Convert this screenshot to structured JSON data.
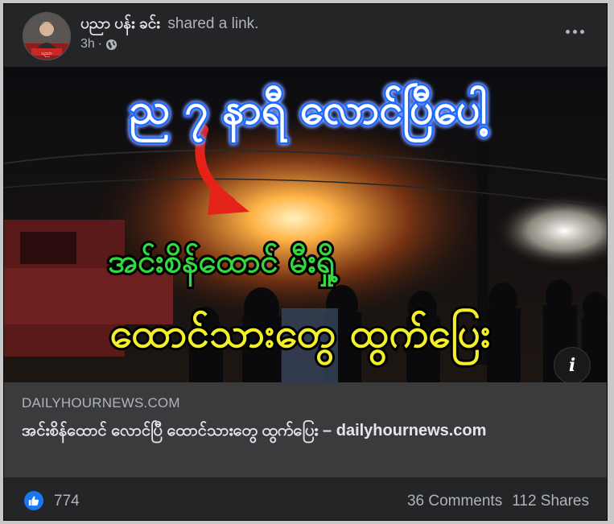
{
  "post": {
    "author": "ပညာ ပန်း ခင်း",
    "action": "shared a link.",
    "timestamp": "3h",
    "separator": "·",
    "privacy_icon": "globe-icon",
    "avatar_caption": "ပညာ",
    "more_icon": "more-horizontal-icon"
  },
  "link_preview": {
    "image_overlay": {
      "line1": "ည ၇ နာရီ လောင်ပြီပေါ့",
      "line2": "အင်းစိန်ထောင် မီးရှို့",
      "line3": "ထောင်သားတွေ ထွက်ပြေး"
    },
    "info_button": "i",
    "domain": "DAILYHOURNEWS.COM",
    "title": "အင်းစိန်ထောင် လောင်ပြီ ထောင်သားတွေ ထွက်ပြေး – dailyhournews.com"
  },
  "reactions": {
    "like_count": "774",
    "comments": "36 Comments",
    "shares": "112 Shares"
  },
  "colors": {
    "card_bg": "#242526",
    "link_meta_bg": "#3a3b3c",
    "like_blue": "#1877f2",
    "overlay_blue": "#1e6bff",
    "overlay_green": "#34d840",
    "overlay_yellow": "#f3f02a"
  }
}
